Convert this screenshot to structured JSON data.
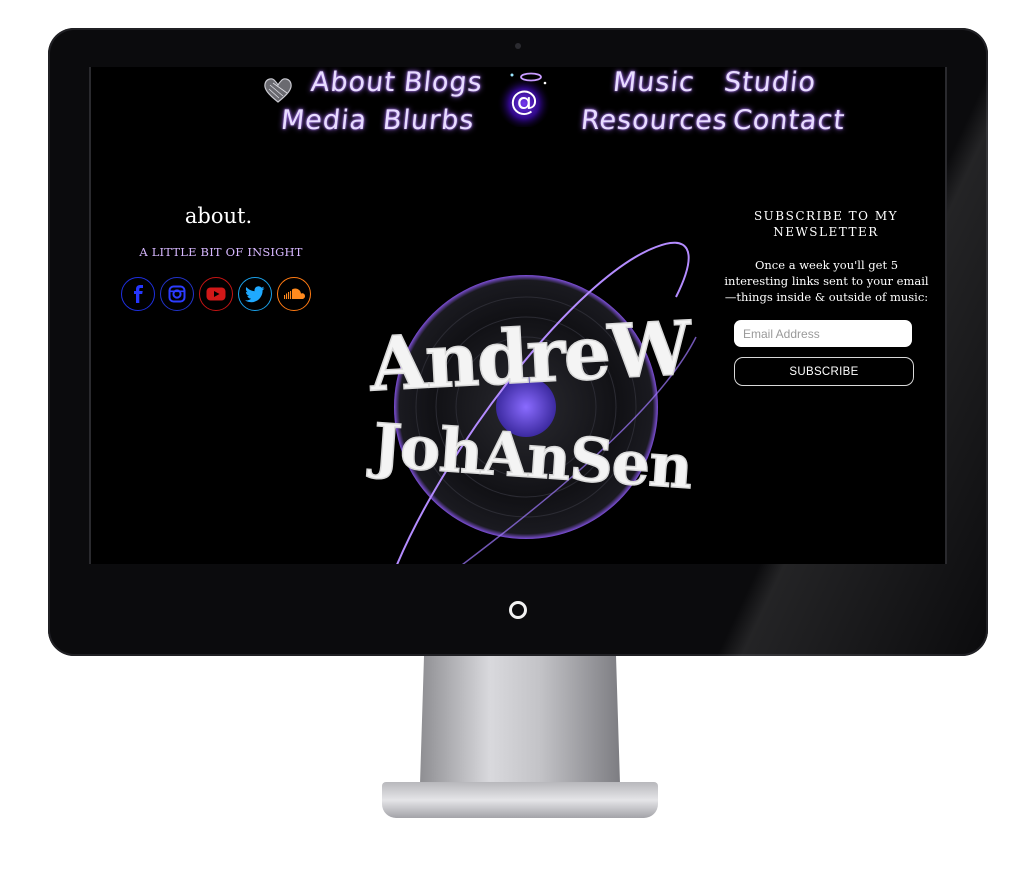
{
  "nav": {
    "row1_left": [
      "About",
      "Blogs"
    ],
    "row1_right": [
      "Music",
      "Studio"
    ],
    "row2_left": [
      "Media",
      "Blurbs"
    ],
    "row2_right": [
      "Resources",
      "Contact"
    ],
    "logo_mark": "@"
  },
  "about": {
    "title": "about.",
    "subtitle": "A LITTLE BIT OF INSIGHT",
    "socials": [
      {
        "name": "facebook-icon",
        "color": "#1e2fe0"
      },
      {
        "name": "instagram-icon",
        "color": "#2233c8"
      },
      {
        "name": "youtube-icon",
        "color": "#c41414"
      },
      {
        "name": "twitter-icon",
        "color": "#1aa0e8"
      },
      {
        "name": "soundcloud-icon",
        "color": "#ff7a12"
      }
    ]
  },
  "hero": {
    "line1": "AndreW",
    "line2": "JohAnSen",
    "accent_color": "#8f5cff"
  },
  "newsletter": {
    "title": "SUBSCRIBE TO MY NEWSLETTER",
    "body": "Once a week you'll get 5 interesting links sent to your email—things inside & outside of music:",
    "email_placeholder": "Email Address",
    "button_label": "SUBSCRIBE"
  }
}
